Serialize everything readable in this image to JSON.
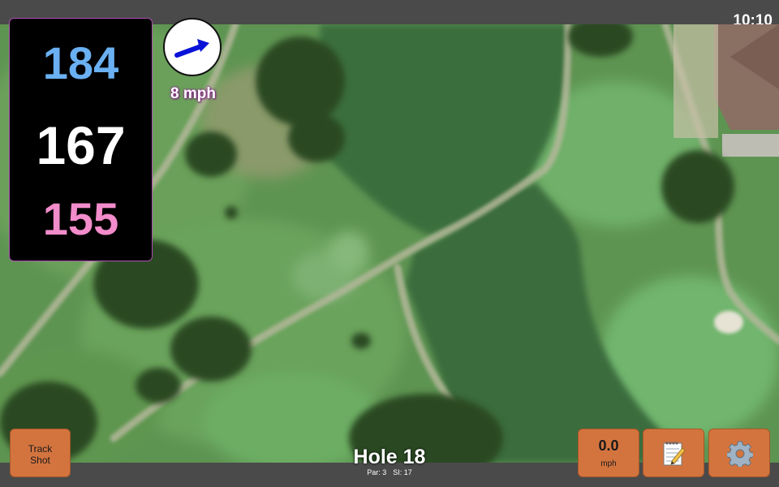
{
  "status": {
    "time": "10:10"
  },
  "distances": {
    "back": "184",
    "center": "167",
    "front": "155"
  },
  "wind": {
    "speed": "8 mph",
    "arrow_color": "#0a12d8"
  },
  "hole": {
    "title": "Hole 18",
    "par": "Par: 3",
    "stroke_index": "SI: 17"
  },
  "buttons": {
    "track_shot_line1": "Track",
    "track_shot_line2": "Shot",
    "speed_value": "0.0",
    "speed_unit": "mph",
    "notes_icon": "notepad-icon",
    "settings_icon": "gear-icon"
  },
  "colors": {
    "button_bg": "#d3743f",
    "panel_bg": "#000000",
    "back_distance": "#6ab0f2",
    "center_distance": "#ffffff",
    "front_distance": "#f38ccb",
    "panel_border": "#b04fb5"
  }
}
